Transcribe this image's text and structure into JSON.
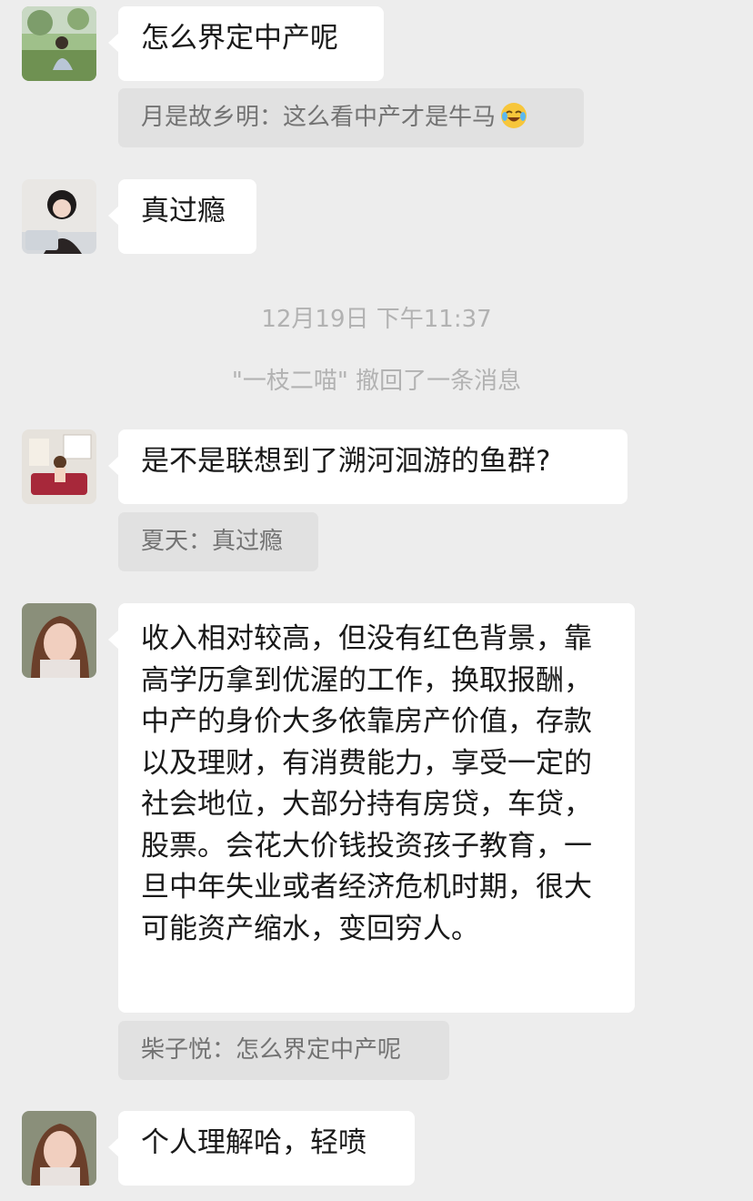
{
  "messages": [
    {
      "text": "怎么界定中产呢",
      "quote": "月是故乡明：这么看中产才是牛马"
    },
    {
      "text": "真过瘾"
    },
    {
      "text": "是不是联想到了溯河洄游的鱼群?",
      "quote": "夏天：真过瘾"
    },
    {
      "text": "收入相对较高，但没有红色背景，靠高学历拿到优渥的工作，换取报酬，中产的身价大多依靠房产价值，存款以及理财，有消费能力，享受一定的社会地位，大部分持有房贷，车贷，股票。会花大价钱投资孩子教育，一旦中年失业或者经济危机时期，很大可能资产缩水，变回穷人。",
      "quote": "柴子悦：怎么界定中产呢"
    },
    {
      "text": "个人理解哈，轻喷"
    }
  ],
  "system": {
    "timestamp": "12月19日 下午11:37",
    "recall": "\"一枝二喵\" 撤回了一条消息"
  },
  "icons": {
    "quote_emoji": "laughing-crying-emoji-icon"
  },
  "colors": {
    "background": "#ededed",
    "bubble": "#ffffff",
    "quote_bg": "#e1e1e1",
    "quote_text": "#737373",
    "system_text": "#b2b2b2"
  }
}
